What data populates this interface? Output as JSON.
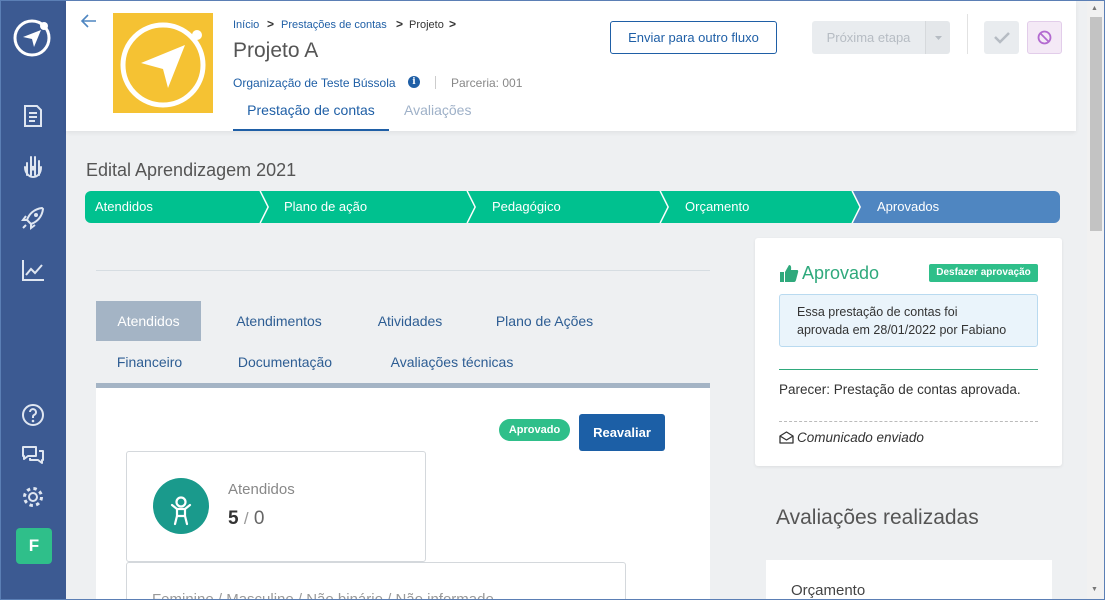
{
  "header": {
    "breadcrumb": [
      "Início",
      "Prestações de contas",
      "Projeto"
    ],
    "breadcrumb_separator": ">",
    "title": "Projeto A",
    "organization": "Organização de Teste Bússola",
    "info_glyph": "i",
    "partnership": "Parceria: 001",
    "tabs": [
      "Prestação de contas",
      "Avaliações"
    ],
    "buttons": {
      "send_other_flow": "Enviar para outro fluxo",
      "next_step": "Próxima etapa"
    }
  },
  "edital": "Edital Aprendizagem 2021",
  "pipeline": {
    "stages": [
      "Atendidos",
      "Plano de ação",
      "Pedagógico",
      "Orçamento",
      "Aprovados"
    ],
    "completed_color": "#00c18f",
    "current_color": "#4f86c1"
  },
  "content_tabs": [
    "Atendidos",
    "Atendimentos",
    "Atividades",
    "Plano de Ações",
    "Financeiro",
    "Documentação",
    "Avaliações técnicas"
  ],
  "panel": {
    "status_badge": "Aprovado",
    "reevaluate_button": "Reavaliar",
    "stat_label": "Atendidos",
    "stat_value": "5",
    "stat_separator": "/",
    "stat_total": "0",
    "gender_label": "Feminino / Masculino / Não binário / Não informado"
  },
  "approval": {
    "title": "Aprovado",
    "undo_button": "Desfazer aprovação",
    "message_line1": "Essa prestação de contas foi",
    "message_line2": "aprovada em 28/01/2022 por Fabiano",
    "opinion": "Parecer: Prestação de contas aprovada.",
    "sent_note": "Comunicado enviado"
  },
  "evaluations": {
    "title": "Avaliações realizadas",
    "first_item": "Orçamento"
  },
  "user": {
    "avatar_letter": "F"
  },
  "icons": {
    "logo": "compass-arrow-icon",
    "nav": [
      "document-icon",
      "hand-heart-icon",
      "rocket-icon",
      "chart-line-icon"
    ],
    "bottom": [
      "help-icon",
      "chat-icon",
      "gear-icon"
    ]
  },
  "colors": {
    "sidebar": "#3c5a92",
    "primary": "#1f5fa6",
    "success": "#2fbf8a",
    "logo_yellow": "#f5c233"
  }
}
